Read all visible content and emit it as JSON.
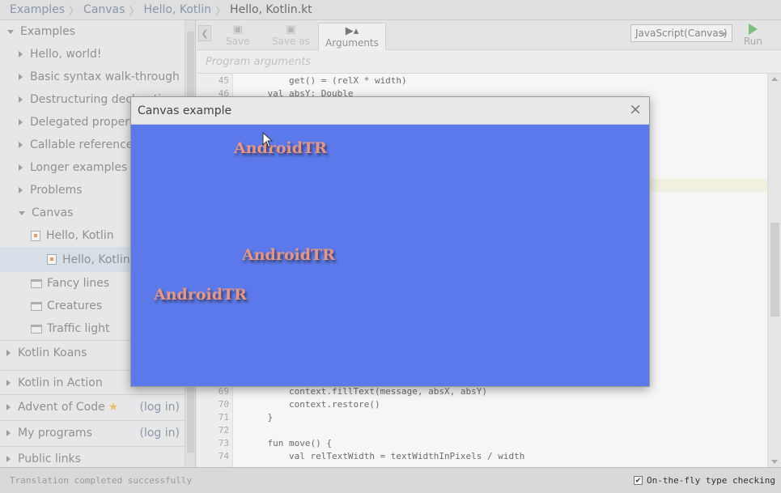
{
  "breadcrumb": [
    "Examples",
    "Canvas",
    "Hello, Kotlin",
    "Hello, Kotlin.kt"
  ],
  "sidebar": {
    "root": "Examples",
    "items": [
      {
        "label": "Hello, world!"
      },
      {
        "label": "Basic syntax walk-through"
      },
      {
        "label": "Destructuring declarations"
      },
      {
        "label": "Delegated properties"
      },
      {
        "label": "Callable references"
      },
      {
        "label": "Longer examples"
      },
      {
        "label": "Problems"
      }
    ],
    "canvas_folder": "Canvas",
    "canvas_children": [
      {
        "label": "Hello, Kotlin"
      },
      {
        "label": "Hello, Kotlin.kt"
      },
      {
        "label": "Fancy lines"
      },
      {
        "label": "Creatures"
      },
      {
        "label": "Traffic light"
      }
    ],
    "sections": [
      {
        "label": "Kotlin Koans",
        "login": ""
      },
      {
        "label": "Kotlin in Action",
        "login": ""
      },
      {
        "label": "Advent of Code",
        "login": "(log in)"
      },
      {
        "label": "My programs",
        "login": "(log in)"
      },
      {
        "label": "Public links",
        "login": ""
      }
    ]
  },
  "toolbar": {
    "save": "Save",
    "save_as": "Save as",
    "arguments": "Arguments",
    "target": "JavaScript(Canvas)",
    "run": "Run"
  },
  "args_placeholder": "Program arguments",
  "code": [
    {
      "n": "45",
      "text": "        get() = (relX * width)"
    },
    {
      "n": "46",
      "text": "    val absY: Double"
    },
    {
      "n": "69",
      "text": "        context.fillText(message, absX, absY)"
    },
    {
      "n": "70",
      "text": "        context.restore()"
    },
    {
      "n": "71",
      "text": "    }"
    },
    {
      "n": "72",
      "text": ""
    },
    {
      "n": "73",
      "text": "    fun move() {"
    },
    {
      "n": "74",
      "text": "        val relTextWidth = textWidthInPixels / width"
    }
  ],
  "dialog": {
    "title": "Canvas example",
    "close": "×",
    "texts": [
      "AndroidTR",
      "AndroidTR",
      "AndroidTR"
    ],
    "bg_color": "#5b79ea",
    "text_color": "#e8967f"
  },
  "status": {
    "message": "Translation completed successfully",
    "on_the_fly": "On-the-fly type checking",
    "on_the_fly_checked": true
  }
}
